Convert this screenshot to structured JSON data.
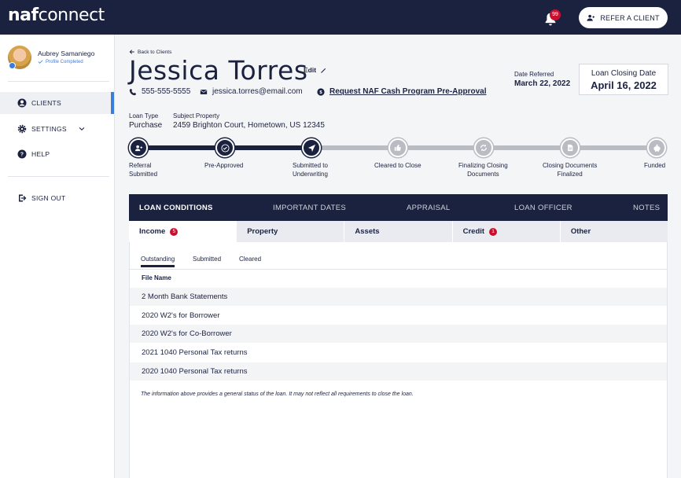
{
  "header": {
    "logo_naf": "naf",
    "logo_connect": "connect",
    "notification_count": "99",
    "refer_button": "REFER A CLIENT"
  },
  "sidebar": {
    "user_name": "Aubrey Samaniego",
    "profile_status": "Profile Completed",
    "items": [
      {
        "label": "CLIENTS",
        "icon": "user-circle-icon",
        "active": true
      },
      {
        "label": "SETTINGS",
        "icon": "gear-icon",
        "active": false
      },
      {
        "label": "HELP",
        "icon": "help-circle-icon",
        "active": false
      }
    ],
    "sign_out": "SIGN OUT"
  },
  "client": {
    "back_label": "Back to Clients",
    "name": "Jessica Torres",
    "edit_label": "Edit",
    "phone": "555-555-5555",
    "email": "jessica.torres@email.com",
    "request_link": "Request NAF Cash Program Pre-Approval",
    "date_referred_label": "Date Referred",
    "date_referred": "March 22, 2022",
    "closing_label": "Loan Closing Date",
    "closing_date": "April 16, 2022",
    "loan_type_label": "Loan Type",
    "loan_type": "Purchase",
    "property_label": "Subject Property",
    "property": "2459 Brighton Court, Hometown, US 12345"
  },
  "progress": {
    "steps": [
      {
        "label1": "Referral",
        "label2": "Submitted",
        "status": "done",
        "icon": "user-icon"
      },
      {
        "label1": "Pre-Approved",
        "label2": "",
        "status": "done",
        "icon": "check-icon"
      },
      {
        "label1": "Submitted to",
        "label2": "Underwriting",
        "status": "done",
        "icon": "send-icon"
      },
      {
        "label1": "Cleared to Close",
        "label2": "",
        "status": "todo",
        "icon": "thumbs-up-icon"
      },
      {
        "label1": "Finalizing Closing",
        "label2": "Documents",
        "status": "todo",
        "icon": "refresh-icon"
      },
      {
        "label1": "Closing Documents",
        "label2": "Finalized",
        "status": "todo",
        "icon": "document-icon"
      },
      {
        "label1": "Funded",
        "label2": "",
        "status": "todo",
        "icon": "piggy-bank-icon"
      }
    ]
  },
  "tabs": [
    "LOAN CONDITIONS",
    "IMPORTANT DATES",
    "APPRAISAL",
    "LOAN OFFICER",
    "NOTES"
  ],
  "subtabs": [
    {
      "label": "Income",
      "badge": "5"
    },
    {
      "label": "Property",
      "badge": ""
    },
    {
      "label": "Assets",
      "badge": ""
    },
    {
      "label": "Credit",
      "badge": "1"
    },
    {
      "label": "Other",
      "badge": ""
    }
  ],
  "filters": [
    "Outstanding",
    "Submitted",
    "Cleared"
  ],
  "table": {
    "column": "File Name",
    "rows": [
      "2 Month Bank Statements",
      "2020 W2's for Borrower",
      "2020 W2's for Co-Borrower",
      "2021 1040 Personal Tax returns",
      "2020 1040 Personal Tax returns"
    ]
  },
  "note": "The information above provides a general status of the loan. It may not reflect all requirements to close the loan.",
  "colors": {
    "navy": "#1b2240",
    "accent": "#3b7ddd",
    "badge": "#c8102e",
    "pending": "#b9bcc3"
  }
}
